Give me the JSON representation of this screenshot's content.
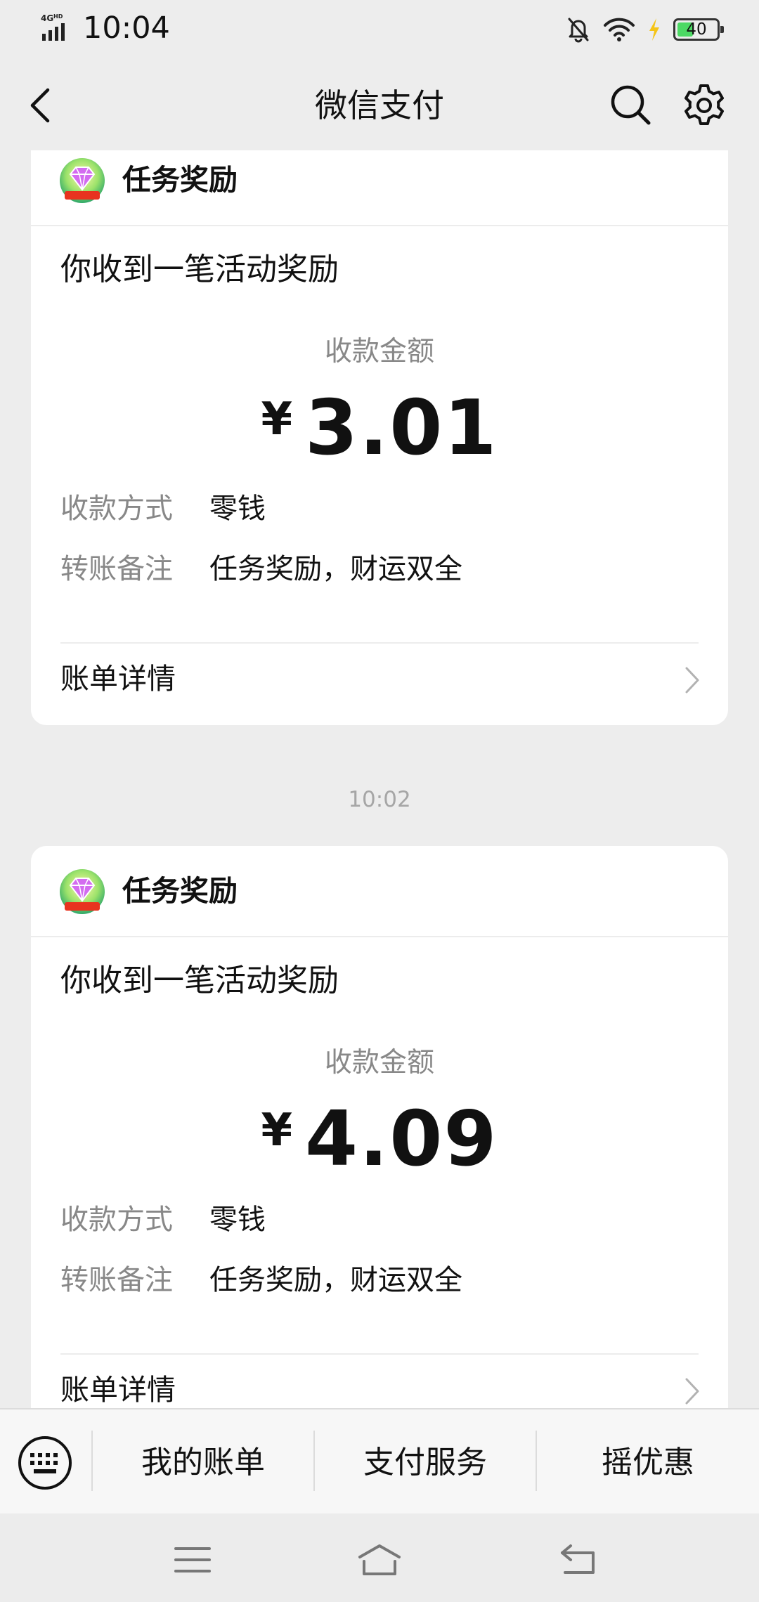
{
  "status_bar": {
    "network": "4G HD",
    "time": "10:04",
    "battery_level": "40",
    "battery_fraction": 0.4,
    "icons": [
      "signal-icon",
      "mute-icon",
      "wifi-icon",
      "charging-icon",
      "battery-icon"
    ]
  },
  "nav": {
    "title": "微信支付",
    "icons": [
      "back-icon",
      "search-icon",
      "gear-icon"
    ]
  },
  "messages": [
    {
      "sender": "任务奖励",
      "title": "你收到一笔活动奖励",
      "amount_label": "收款金额",
      "currency": "¥",
      "amount": "3.01",
      "details": [
        {
          "key": "收款方式",
          "value": "零钱"
        },
        {
          "key": "转账备注",
          "value": "任务奖励，财运双全"
        }
      ],
      "bill_label": "账单详情"
    },
    {
      "time": "10:02",
      "sender": "任务奖励",
      "title": "你收到一笔活动奖励",
      "amount_label": "收款金额",
      "currency": "¥",
      "amount": "4.09",
      "details": [
        {
          "key": "收款方式",
          "value": "零钱"
        },
        {
          "key": "转账备注",
          "value": "任务奖励，财运双全"
        }
      ],
      "bill_label": "账单详情"
    }
  ],
  "bottom_menu": {
    "keyboard_icon": "keyboard-icon",
    "items": [
      "我的账单",
      "支付服务",
      "摇优惠"
    ]
  },
  "system_nav": [
    "menu-icon",
    "home-icon",
    "back-icon"
  ],
  "colors": {
    "background": "#ededed",
    "card": "#ffffff",
    "muted_text": "#888888",
    "battery_green": "#4cd964",
    "charging_yellow": "#f5c518"
  }
}
